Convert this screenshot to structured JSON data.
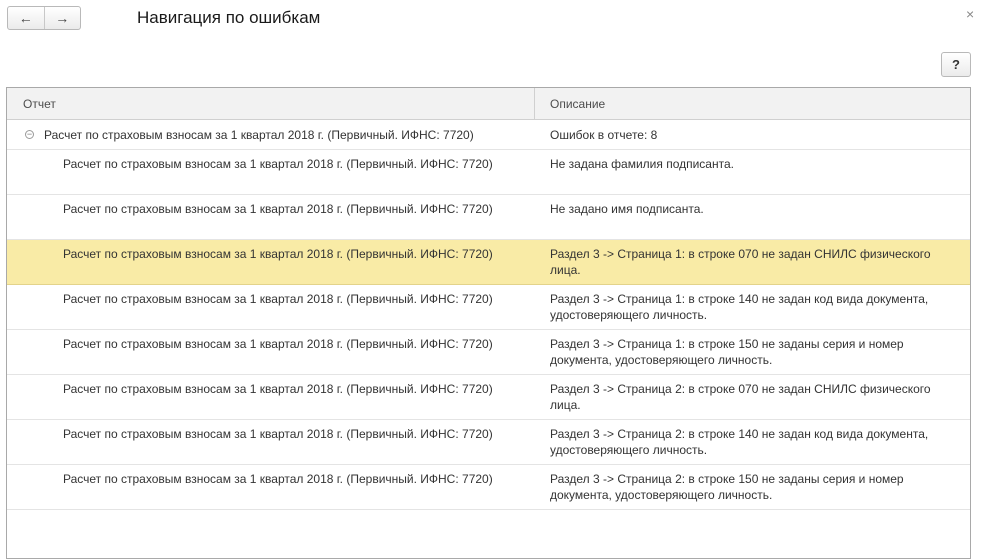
{
  "window": {
    "title": "Навигация по ошибкам",
    "back_icon": "←",
    "forward_icon": "→",
    "close_icon": "×",
    "help_label": "?"
  },
  "table": {
    "headers": {
      "report": "Отчет",
      "description": "Описание"
    },
    "group": {
      "collapse_icon": "−",
      "report": "Расчет по страховым взносам за 1 квартал 2018 г. (Первичный. ИФНС: 7720)",
      "description": "Ошибок в отчете: 8"
    },
    "rows": [
      {
        "report": "Расчет по страховым взносам за 1 квартал 2018 г. (Первичный. ИФНС: 7720)",
        "description": "Не задана фамилия подписанта."
      },
      {
        "report": "Расчет по страховым взносам за 1 квартал 2018 г. (Первичный. ИФНС: 7720)",
        "description": "Не задано имя подписанта."
      },
      {
        "report": "Расчет по страховым взносам за 1 квартал 2018 г. (Первичный. ИФНС: 7720)",
        "description": "Раздел 3 -> Страница 1: в строке 070 не задан СНИЛС физического лица."
      },
      {
        "report": "Расчет по страховым взносам за 1 квартал 2018 г. (Первичный. ИФНС: 7720)",
        "description": "Раздел 3 -> Страница 1: в строке 140 не задан код вида документа, удостоверяющего личность."
      },
      {
        "report": "Расчет по страховым взносам за 1 квартал 2018 г. (Первичный. ИФНС: 7720)",
        "description": "Раздел 3 -> Страница 1: в строке 150 не заданы серия и номер документа, удостоверяющего личность."
      },
      {
        "report": "Расчет по страховым взносам за 1 квартал 2018 г. (Первичный. ИФНС: 7720)",
        "description": "Раздел 3 -> Страница 2: в строке 070 не задан СНИЛС физического лица."
      },
      {
        "report": "Расчет по страховым взносам за 1 квартал 2018 г. (Первичный. ИФНС: 7720)",
        "description": "Раздел 3 -> Страница 2: в строке 140 не задан код вида документа, удостоверяющего личность."
      },
      {
        "report": "Расчет по страховым взносам за 1 квартал 2018 г. (Первичный. ИФНС: 7720)",
        "description": "Раздел 3 -> Страница 2: в строке 150 не заданы серия и номер документа, удостоверяющего личность."
      }
    ]
  },
  "colors": {
    "selected_row": "#f9eba6",
    "header_bg": "#f2f2f2"
  }
}
